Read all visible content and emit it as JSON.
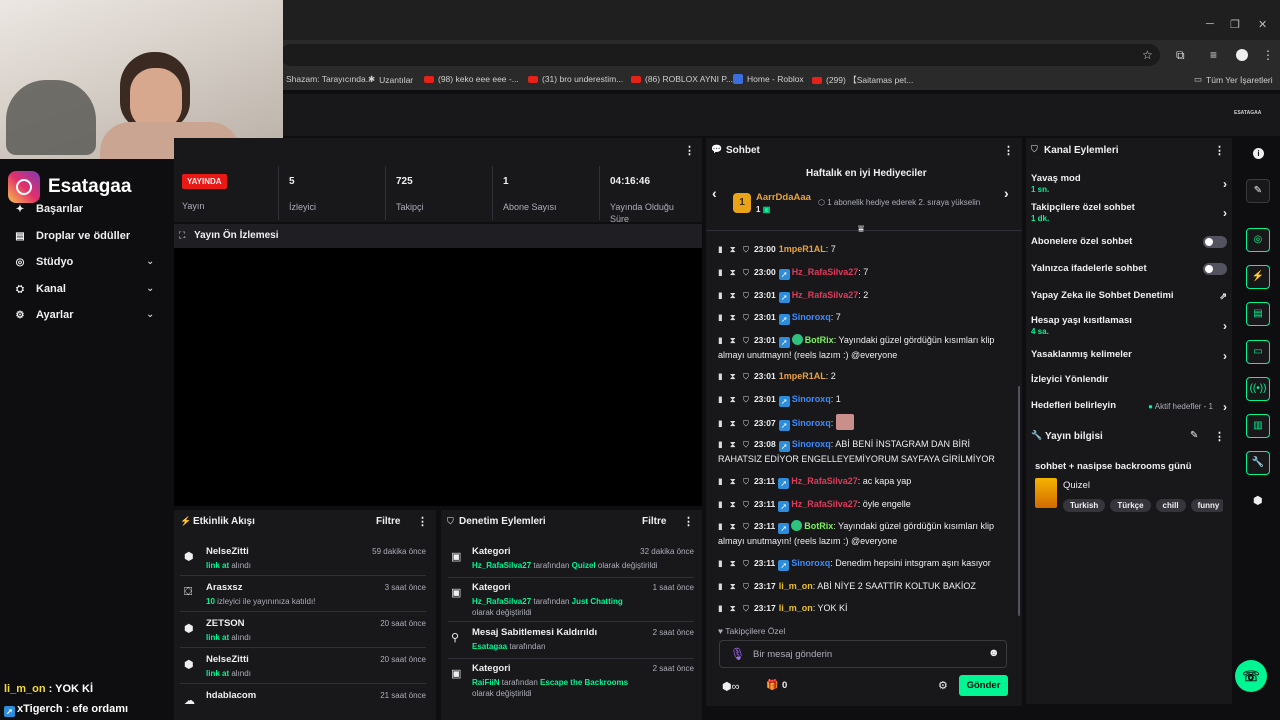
{
  "browser": {
    "bookmarks": [
      {
        "label": "Shazam: Tarayıcında...",
        "icon": "shazam-icon"
      },
      {
        "label": "Uzantılar",
        "icon": "puzzle-icon"
      },
      {
        "label": "(98) keko eee eee -...",
        "icon": "youtube-icon"
      },
      {
        "label": "(31) bro underestim...",
        "icon": "youtube-icon"
      },
      {
        "label": "(86) ROBLOX AYNI P...",
        "icon": "youtube-icon"
      },
      {
        "label": "Home - Roblox",
        "icon": "roblox-icon"
      },
      {
        "label": "(299) 【Saitamas pet...",
        "icon": "youtube-icon"
      },
      {
        "label": "Tüm Yer İşaretleri",
        "icon": "folder-icon"
      }
    ]
  },
  "topnav": {
    "channel_label": "ESATAGAA"
  },
  "overlay": {
    "brand_name": "Esatagaa",
    "chat_lines": [
      {
        "user": "li_m_on",
        "text": " : YOK Kİ"
      },
      {
        "user": "xTigerch",
        "text": " : efe ordamı"
      }
    ]
  },
  "sidebar": {
    "items": [
      {
        "label": "Başarılar",
        "icon": "trophy-icon",
        "has_chevron": false
      },
      {
        "label": "Droplar ve ödüller",
        "icon": "gift-icon",
        "has_chevron": false
      },
      {
        "label": "Stüdyo",
        "icon": "studio-icon",
        "has_chevron": true
      },
      {
        "label": "Kanal",
        "icon": "channel-icon",
        "has_chevron": true
      },
      {
        "label": "Ayarlar",
        "icon": "gear-icon",
        "has_chevron": true
      }
    ]
  },
  "stats": {
    "live_badge": "YAYINDA",
    "stream_label": "Yayın",
    "items": [
      {
        "value": "5",
        "label": "İzleyici"
      },
      {
        "value": "725",
        "label": "Takipçi"
      },
      {
        "value": "1",
        "label": "Abone Sayısı"
      },
      {
        "value": "04:16:46",
        "label": "Yayında Olduğu Süre"
      }
    ]
  },
  "preview": {
    "title": "Yayın Ön İzlemesi"
  },
  "activity": {
    "title": "Etkinlik Akışı",
    "filter": "Filtre",
    "items": [
      {
        "name": "NelseZitti",
        "sub": "link at",
        "sub_suffix": " alındı",
        "time": "59 dakika önce",
        "icon": "points-icon"
      },
      {
        "name": "Arasxsz",
        "sub": "10",
        "sub_suffix": " izleyici ile yayınınıza katıldı!",
        "time": "3 saat önce",
        "icon": "raid-icon"
      },
      {
        "name": "ZETSON",
        "sub": "link at",
        "sub_suffix": " alındı",
        "time": "20 saat önce",
        "icon": "points-icon"
      },
      {
        "name": "NelseZitti",
        "sub": "link at",
        "sub_suffix": " alındı",
        "time": "20 saat önce",
        "icon": "points-icon"
      },
      {
        "name": "hdablacom",
        "sub": "",
        "sub_suffix": "",
        "time": "21 saat önce",
        "icon": "follow-icon"
      }
    ]
  },
  "moderation": {
    "title": "Denetim Eylemleri",
    "filter": "Filtre",
    "items": [
      {
        "title": "Kategori",
        "user": "Hz_RafaSilva27",
        "mid": " tarafından ",
        "target": "Quizel",
        "end": " olarak değiştirildi",
        "time": "32 dakika önce",
        "icon": "category-icon"
      },
      {
        "title": "Kategori",
        "user": "Hz_RafaSilva27",
        "mid": " tarafından ",
        "target": "Just Chatting",
        "end": " olarak değiştirildi",
        "time": "1 saat önce",
        "icon": "category-icon"
      },
      {
        "title": "Mesaj Sabitlemesi Kaldırıldı",
        "user": "Esatagaa",
        "mid": " tarafından",
        "target": "",
        "end": "",
        "time": "2 saat önce",
        "icon": "unpin-icon"
      },
      {
        "title": "Kategori",
        "user": "RaiFiiN",
        "mid": " tarafından ",
        "target": "Escape the Backrooms",
        "end": " olarak değiştirildi",
        "time": "2 saat önce",
        "icon": "category-icon"
      }
    ]
  },
  "chat": {
    "title": "Sohbet",
    "gifters_title": "Haftalık en iyi Hediyeciler",
    "top_gifter": {
      "rank": "1",
      "name": "AarrDdaAaa",
      "count": "1",
      "note": "1 abonelik hediye ederek 2. sıraya yükselin"
    },
    "messages": [
      {
        "time": "23:00",
        "user": "1mpeR1AL",
        "color": "#e8a33d",
        "badge": false,
        "verified": false,
        "text": ": 7"
      },
      {
        "time": "23:00",
        "user": "Hz_RafaSilva27",
        "color": "#e03a5a",
        "badge": true,
        "verified": false,
        "text": ": 7"
      },
      {
        "time": "23:01",
        "user": "Hz_RafaSilva27",
        "color": "#e03a5a",
        "badge": true,
        "verified": false,
        "text": ": 2"
      },
      {
        "time": "23:01",
        "user": "Sinoroxq",
        "color": "#3d8bfd",
        "badge": true,
        "verified": false,
        "text": ": 7"
      },
      {
        "time": "23:01",
        "user": "BotRix",
        "color": "#7cf259",
        "badge": true,
        "verified": true,
        "text": ": Yayındaki güzel gördüğün kısımları klip almayı unutmayın! (reels lazım :) @everyone"
      },
      {
        "time": "23:01",
        "user": "1mpeR1AL",
        "color": "#e8a33d",
        "badge": false,
        "verified": false,
        "text": ": 2"
      },
      {
        "time": "23:01",
        "user": "Sinoroxq",
        "color": "#3d8bfd",
        "badge": true,
        "verified": false,
        "text": ": 1"
      },
      {
        "time": "23:07",
        "user": "Sinoroxq",
        "color": "#3d8bfd",
        "badge": true,
        "verified": false,
        "text": ":",
        "emote": true
      },
      {
        "time": "23:08",
        "user": "Sinoroxq",
        "color": "#3d8bfd",
        "badge": true,
        "verified": false,
        "text": ": ABİ BENİ İNSTAGRAM DAN BİRİ RAHATSIZ EDİYOR ENGELLEYEMİYORUM SAYFAYA GİRİLMİYOR"
      },
      {
        "time": "23:11",
        "user": "Hz_RafaSilva27",
        "color": "#e03a5a",
        "badge": true,
        "verified": false,
        "text": ": ac kapa yap"
      },
      {
        "time": "23:11",
        "user": "Hz_RafaSilva27",
        "color": "#e03a5a",
        "badge": true,
        "verified": false,
        "text": ": öyle engelle"
      },
      {
        "time": "23:11",
        "user": "BotRix",
        "color": "#7cf259",
        "badge": true,
        "verified": true,
        "text": ": Yayındaki güzel gördüğün kısımları klip almayı unutmayın! (reels lazım :) @everyone"
      },
      {
        "time": "23:11",
        "user": "Sinoroxq",
        "color": "#3d8bfd",
        "badge": true,
        "verified": false,
        "text": ": Denedim hepsini intsgram aşırı kasıyor"
      },
      {
        "time": "23:17",
        "user": "li_m_on",
        "color": "#e8c02a",
        "badge": false,
        "verified": false,
        "text": ": ABİ NİYE 2 SAATTİR KOLTUK BAKİOZ"
      },
      {
        "time": "23:17",
        "user": "li_m_on",
        "color": "#e8c02a",
        "badge": false,
        "verified": false,
        "text": ": YOK Kİ"
      }
    ],
    "followers_only": "Takipçilere Özel",
    "input_placeholder": "Bir mesaj gönderin",
    "points": "0",
    "send_label": "Gönder"
  },
  "channel_actions": {
    "title": "Kanal Eylemleri",
    "items": [
      {
        "label": "Yavaş mod",
        "sub": "1 sn.",
        "control": "arrow"
      },
      {
        "label": "Takipçilere özel sohbet",
        "sub": "1 dk.",
        "control": "arrow"
      },
      {
        "label": "Abonelere özel sohbet",
        "sub": "",
        "control": "toggle"
      },
      {
        "label": "Yalnızca ifadelerle sohbet",
        "sub": "",
        "control": "toggle"
      },
      {
        "label": "Yapay Zeka ile Sohbet Denetimi",
        "sub": "",
        "control": "external"
      },
      {
        "label": "Hesap yaşı kısıtlaması",
        "sub": "4 sa.",
        "control": "arrow"
      },
      {
        "label": "Yasaklanmış kelimeler",
        "sub": "",
        "control": "arrow"
      },
      {
        "label": "İzleyici Yönlendir",
        "sub": "",
        "control": "none"
      },
      {
        "label": "Hedefleri belirleyin",
        "sub": "",
        "control": "arrow",
        "status": "Aktif hedefler - 1"
      }
    ]
  },
  "stream_info": {
    "title": "Yayın bilgisi",
    "stream_title": "sohbet + nasipse backrooms günü",
    "category": "Quizel",
    "tags": [
      "Turkish",
      "Türkçe",
      "chill",
      "funny"
    ]
  },
  "colors": {
    "accent": "#00f593",
    "live": "#e91916",
    "panel": "#18181b",
    "background": "#0e0e10"
  }
}
